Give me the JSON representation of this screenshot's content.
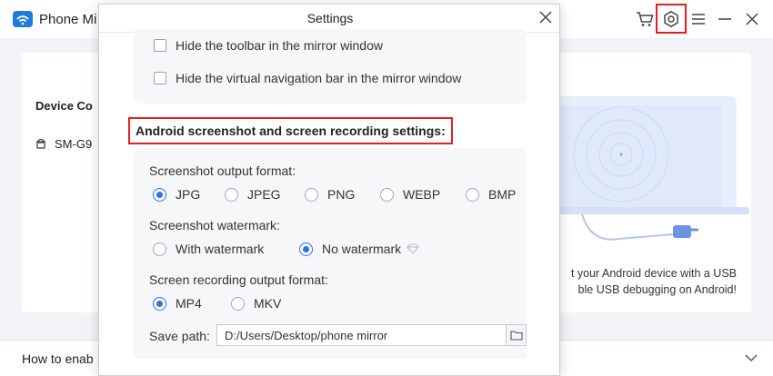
{
  "app": {
    "title": "Phone Mi",
    "left_panel": {
      "header": "Device Co",
      "device": "SM-G9"
    },
    "connect_text_line1": "t your Android device with a USB",
    "connect_text_line2": "ble USB debugging on Android!",
    "bottom_text": "How to enab",
    "icons": [
      "cart-icon",
      "settings-icon",
      "menu-icon",
      "minimize-icon",
      "close-icon"
    ]
  },
  "dialog": {
    "title": "Settings",
    "hide_toolbar": {
      "label": "Hide the toolbar in the mirror window",
      "checked": false
    },
    "hide_navbar": {
      "label": "Hide the virtual navigation bar in the mirror window",
      "checked": false
    },
    "section_title": "Android screenshot and screen recording settings:",
    "screenshot_format": {
      "label": "Screenshot output format:",
      "options": [
        "JPG",
        "JPEG",
        "PNG",
        "WEBP",
        "BMP"
      ],
      "selected": "JPG"
    },
    "watermark": {
      "label": "Screenshot watermark:",
      "options": [
        "With watermark",
        "No watermark"
      ],
      "selected": "No watermark"
    },
    "recording_format": {
      "label": "Screen recording output format:",
      "options": [
        "MP4",
        "MKV"
      ],
      "selected": "MP4"
    },
    "save_path": {
      "label": "Save path:",
      "value": "D:/Users/Desktop/phone mirror"
    }
  },
  "colors": {
    "accent": "#2f6fe8",
    "highlight": "#e02020",
    "brand": "#1f7ae0"
  }
}
